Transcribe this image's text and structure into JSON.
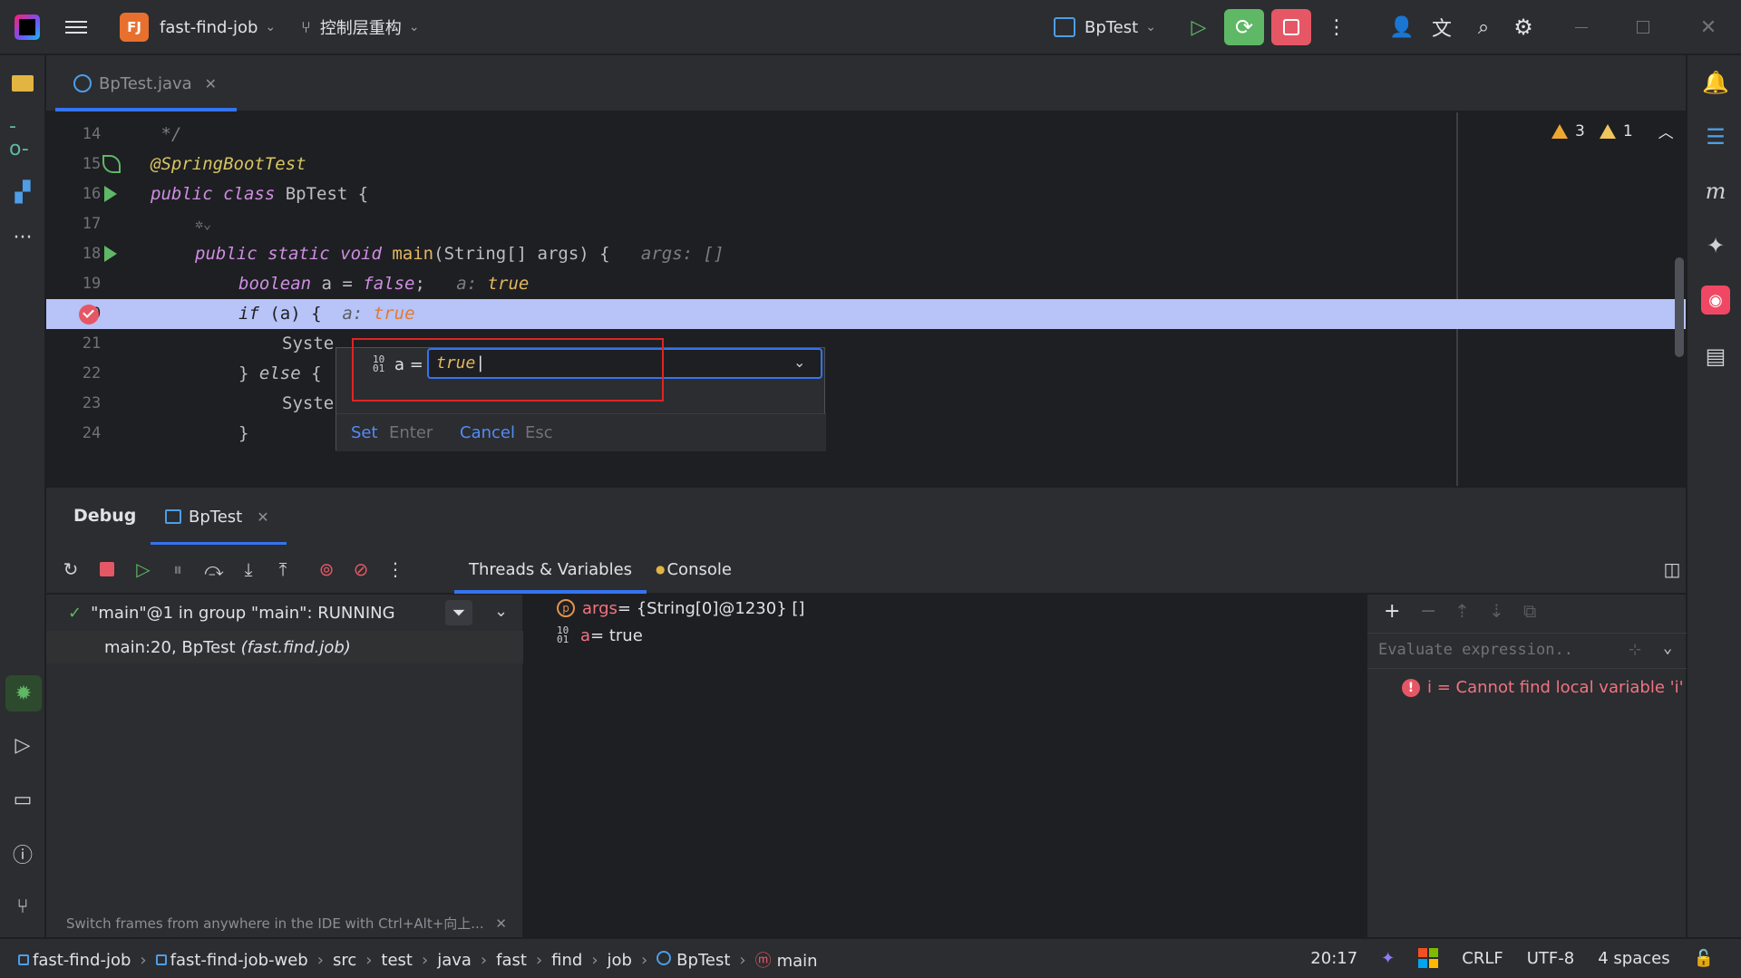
{
  "titlebar": {
    "project_badge": "FJ",
    "project_name": "fast-find-job",
    "branch": "控制层重构",
    "run_config": "BpTest"
  },
  "editor": {
    "tab": "BpTest.java",
    "inspections": {
      "warnings": "3",
      "weak_warnings": "1"
    },
    "lines": [
      {
        "n": "14",
        "text": " */"
      },
      {
        "n": "15",
        "annotation": "@SpringBootTest"
      },
      {
        "n": "16",
        "kw": "public class",
        "name": " BpTest {"
      },
      {
        "n": "17",
        "text": ""
      },
      {
        "n": "18",
        "kw": "public static void",
        "fn": "main",
        "rest": "(String[] args) {",
        "hint": "args: []"
      },
      {
        "n": "19",
        "kw": "boolean",
        "rest": " a = ",
        "kw2": "false",
        "rest2": ";",
        "hint": "a:",
        "hint_val": "true"
      },
      {
        "n": "20",
        "kw": "if",
        "rest": " (a) {",
        "hint": "a:",
        "hint_val": "true"
      },
      {
        "n": "21",
        "text": "Syste"
      },
      {
        "n": "22",
        "rest": "} ",
        "kw": "else",
        "rest2": " {"
      },
      {
        "n": "23",
        "text": "Syste"
      },
      {
        "n": "24",
        "text": "}"
      }
    ]
  },
  "popup": {
    "var_label": "a =",
    "value": "true",
    "set_label": "Set",
    "set_key": "Enter",
    "cancel_label": "Cancel",
    "cancel_key": "Esc"
  },
  "debug": {
    "title": "Debug",
    "session_tab": "BpTest",
    "subtabs": {
      "threads": "Threads & Variables",
      "console": "Console"
    },
    "thread": "\"main\"@1 in group \"main\": RUNNING",
    "frame_loc": "main:20, BpTest",
    "frame_pkg": "(fast.find.job)",
    "tip": "Switch frames from anywhere in the IDE with Ctrl+Alt+向上...",
    "variables": [
      {
        "name": "args",
        "value": " = {String[0]@1230} []"
      },
      {
        "name": "a",
        "value": " = true"
      }
    ],
    "eval_placeholder": "Evaluate expression..",
    "error": "i = Cannot find local variable 'i'"
  },
  "statusbar": {
    "crumbs": [
      "fast-find-job",
      "fast-find-job-web",
      "src",
      "test",
      "java",
      "fast",
      "find",
      "job",
      "BpTest",
      "main"
    ],
    "position": "20:17",
    "line_sep": "CRLF",
    "encoding": "UTF-8",
    "indent": "4 spaces"
  },
  "colors": {
    "accent": "#3574f0",
    "run_green": "#5fb865",
    "stop_red": "#e55765",
    "highlight": "#b8c3f8"
  }
}
